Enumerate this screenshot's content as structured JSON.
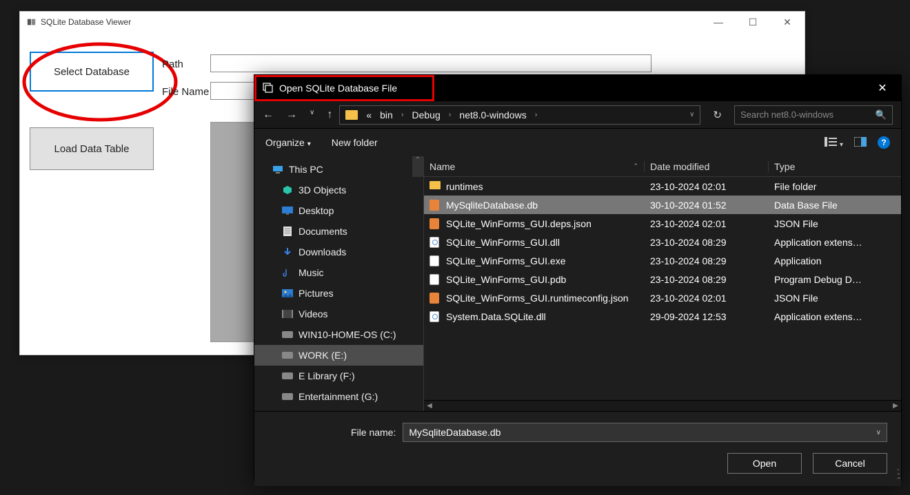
{
  "app": {
    "title": "SQLite Database Viewer",
    "buttons": {
      "select_label": "Select Database",
      "load_label": "Load Data Table"
    },
    "labels": {
      "path": "Path",
      "file_name": "File Name"
    },
    "fields": {
      "path_value": "",
      "filename_value": ""
    }
  },
  "dialog": {
    "title": "Open SQLite Database File",
    "breadcrumb": {
      "prefix": "«",
      "parts": [
        "bin",
        "Debug",
        "net8.0-windows"
      ]
    },
    "search_placeholder": "Search net8.0-windows",
    "toolbar": {
      "organize": "Organize",
      "new_folder": "New folder"
    },
    "tree": [
      {
        "label": "This PC",
        "level": 0,
        "icon": "pc"
      },
      {
        "label": "3D Objects",
        "level": 1,
        "icon": "3d"
      },
      {
        "label": "Desktop",
        "level": 1,
        "icon": "desktop"
      },
      {
        "label": "Documents",
        "level": 1,
        "icon": "doc"
      },
      {
        "label": "Downloads",
        "level": 1,
        "icon": "down"
      },
      {
        "label": "Music",
        "level": 1,
        "icon": "music"
      },
      {
        "label": "Pictures",
        "level": 1,
        "icon": "pic"
      },
      {
        "label": "Videos",
        "level": 1,
        "icon": "video"
      },
      {
        "label": "WIN10-HOME-OS (C:)",
        "level": 1,
        "icon": "drive"
      },
      {
        "label": "WORK (E:)",
        "level": 1,
        "icon": "drive",
        "selected": true
      },
      {
        "label": "E Library (F:)",
        "level": 1,
        "icon": "drive"
      },
      {
        "label": "Entertainment (G:)",
        "level": 1,
        "icon": "drive"
      }
    ],
    "columns": {
      "name": "Name",
      "date": "Date modified",
      "type": "Type"
    },
    "rows": [
      {
        "name": "runtimes",
        "date": "23-10-2024 02:01",
        "type": "File folder",
        "icon": "folder"
      },
      {
        "name": "MySqliteDatabase.db",
        "date": "30-10-2024 01:52",
        "type": "Data Base File",
        "icon": "db",
        "selected": true
      },
      {
        "name": "SQLite_WinForms_GUI.deps.json",
        "date": "23-10-2024 02:01",
        "type": "JSON File",
        "icon": "json"
      },
      {
        "name": "SQLite_WinForms_GUI.dll",
        "date": "23-10-2024 08:29",
        "type": "Application extens…",
        "icon": "dll"
      },
      {
        "name": "SQLite_WinForms_GUI.exe",
        "date": "23-10-2024 08:29",
        "type": "Application",
        "icon": "exe"
      },
      {
        "name": "SQLite_WinForms_GUI.pdb",
        "date": "23-10-2024 08:29",
        "type": "Program Debug D…",
        "icon": "pdb"
      },
      {
        "name": "SQLite_WinForms_GUI.runtimeconfig.json",
        "date": "23-10-2024 02:01",
        "type": "JSON File",
        "icon": "json"
      },
      {
        "name": "System.Data.SQLite.dll",
        "date": "29-09-2024 12:53",
        "type": "Application extens…",
        "icon": "dll"
      }
    ],
    "filename_label": "File name:",
    "filename_value": "MySqliteDatabase.db",
    "buttons": {
      "open": "Open",
      "cancel": "Cancel"
    }
  }
}
